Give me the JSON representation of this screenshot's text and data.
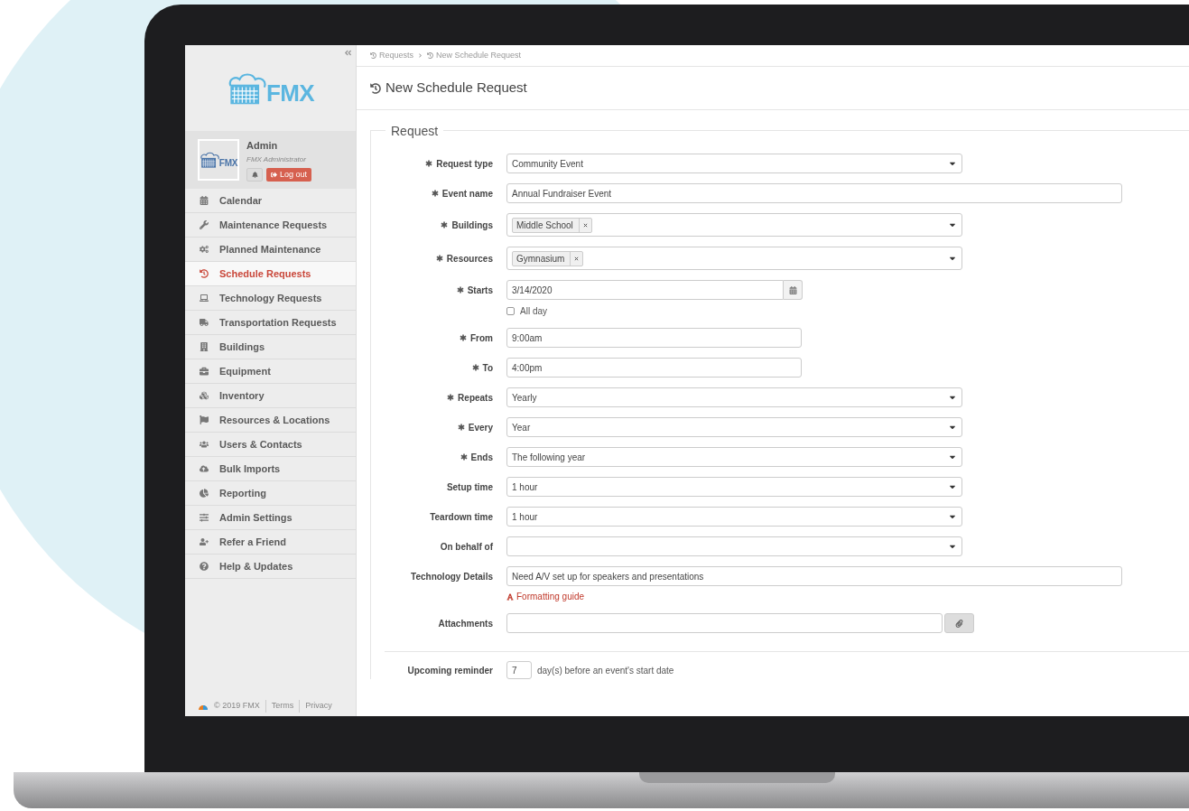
{
  "sidebar": {
    "logo_text": "FMX",
    "user": {
      "avatar_text": "FMX",
      "name": "Admin",
      "role": "FMX Administrator",
      "logout": "Log out"
    },
    "items": [
      {
        "label": "Calendar",
        "selected": false
      },
      {
        "label": "Maintenance Requests",
        "selected": false
      },
      {
        "label": "Planned Maintenance",
        "selected": false
      },
      {
        "label": "Schedule Requests",
        "selected": true
      },
      {
        "label": "Technology Requests",
        "selected": false
      },
      {
        "label": "Transportation Requests",
        "selected": false
      },
      {
        "label": "Buildings",
        "selected": false
      },
      {
        "label": "Equipment",
        "selected": false
      },
      {
        "label": "Inventory",
        "selected": false
      },
      {
        "label": "Resources & Locations",
        "selected": false
      },
      {
        "label": "Users & Contacts",
        "selected": false
      },
      {
        "label": "Bulk Imports",
        "selected": false
      },
      {
        "label": "Reporting",
        "selected": false
      },
      {
        "label": "Admin Settings",
        "selected": false
      },
      {
        "label": "Refer a Friend",
        "selected": false
      },
      {
        "label": "Help & Updates",
        "selected": false
      }
    ],
    "footer": {
      "copyright": "© 2019 FMX",
      "links": [
        "Terms",
        "Privacy"
      ]
    }
  },
  "breadcrumb": [
    "Requests",
    "New Schedule Request"
  ],
  "page_title": "New Schedule Request",
  "form": {
    "legend": "Request",
    "fields": [
      {
        "kind": "select",
        "label": "Request type",
        "required": true,
        "value": "Community Event"
      },
      {
        "kind": "text",
        "label": "Event name",
        "required": true,
        "value": "Annual Fundraiser Event"
      },
      {
        "kind": "tags",
        "label": "Buildings",
        "required": true,
        "tags": [
          "Middle School"
        ]
      },
      {
        "kind": "tags",
        "label": "Resources",
        "required": true,
        "tags": [
          "Gymnasium"
        ]
      },
      {
        "kind": "date",
        "label": "Starts",
        "required": true,
        "value": "3/14/2020"
      },
      {
        "kind": "checkbox",
        "label": "All day",
        "checked": false
      },
      {
        "kind": "time",
        "label": "From",
        "required": true,
        "value": "9:00am"
      },
      {
        "kind": "time",
        "label": "To",
        "required": true,
        "value": "4:00pm"
      },
      {
        "kind": "select",
        "label": "Repeats",
        "required": true,
        "value": "Yearly"
      },
      {
        "kind": "select",
        "label": "Every",
        "required": true,
        "value": "Year"
      },
      {
        "kind": "select",
        "label": "Ends",
        "required": true,
        "value": "The following year"
      },
      {
        "kind": "select",
        "label": "Setup time",
        "required": false,
        "value": "1 hour"
      },
      {
        "kind": "select",
        "label": "Teardown time",
        "required": false,
        "value": "1 hour"
      },
      {
        "kind": "select",
        "label": "On behalf of",
        "required": false
      },
      {
        "kind": "textarea",
        "label": "Technology Details",
        "required": false,
        "value": "Need A/V set up for speakers and presentations",
        "link": "Formatting guide"
      },
      {
        "kind": "file",
        "label": "Attachments",
        "required": false
      }
    ],
    "reminder": {
      "label": "Upcoming reminder",
      "value": "7",
      "suffix": "day(s) before an event's start date"
    }
  }
}
